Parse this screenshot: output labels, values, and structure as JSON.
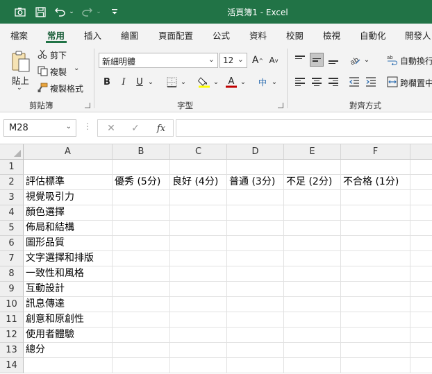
{
  "titlebar": {
    "title": "活頁簿1  -  Excel",
    "icons": [
      "camera-icon",
      "save-icon",
      "undo-icon",
      "redo-icon",
      "customize-icon"
    ]
  },
  "tabs": [
    "檔案",
    "常用",
    "插入",
    "繪圖",
    "頁面配置",
    "公式",
    "資料",
    "校閱",
    "檢視",
    "自動化",
    "開發人"
  ],
  "active_tab": "常用",
  "ribbon": {
    "clipboard": {
      "paste": "貼上",
      "cut": "剪下",
      "copy": "複製",
      "format_painter": "複製格式",
      "group": "剪貼簿"
    },
    "font": {
      "name": "新細明體",
      "size": "12",
      "grow": "A",
      "shrink": "A",
      "bold": "B",
      "italic": "I",
      "underline": "U",
      "phonetic": "中",
      "group": "字型"
    },
    "alignment": {
      "wrap": "自動換行",
      "merge": "跨欄置中",
      "group": "對齊方式"
    }
  },
  "formula_bar": {
    "name_box": "M28",
    "fx": "fx",
    "value": ""
  },
  "sheet": {
    "columns": [
      "A",
      "B",
      "C",
      "D",
      "E",
      "F"
    ],
    "rows": [
      "1",
      "2",
      "3",
      "4",
      "5",
      "6",
      "7",
      "8",
      "9",
      "10",
      "11",
      "12",
      "13",
      "14"
    ],
    "header_row": [
      "評估標準",
      "優秀 (5分)",
      "良好 (4分)",
      "普通 (3分)",
      "不足 (2分)",
      "不合格 (1分)"
    ],
    "criteria": [
      "視覺吸引力",
      "顏色選擇",
      "佈局和結構",
      "圖形品質",
      "文字選擇和排版",
      "一致性和風格",
      "互動設計",
      "訊息傳達",
      "創意和原創性",
      "使用者體驗",
      "總分"
    ]
  },
  "colors": {
    "excel_green": "#217346",
    "font_color": "#c00000",
    "highlight": "#ffff00"
  }
}
